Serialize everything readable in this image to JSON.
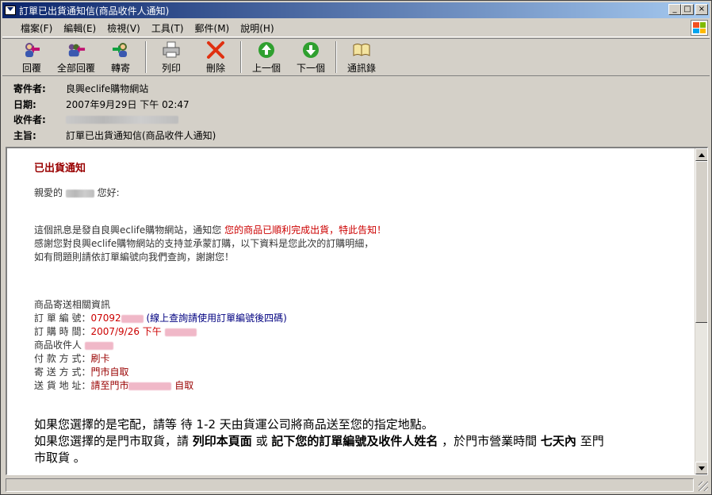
{
  "window": {
    "title": "訂單已出貨通知信(商品收件人通知)",
    "controls": [
      "_",
      "□",
      "×"
    ]
  },
  "menu": [
    "檔案(F)",
    "編輯(E)",
    "檢視(V)",
    "工具(T)",
    "郵件(M)",
    "說明(H)"
  ],
  "toolbar": {
    "reply": "回覆",
    "reply_all": "全部回覆",
    "forward": "轉寄",
    "print": "列印",
    "delete": "刪除",
    "prev": "上一個",
    "next": "下一個",
    "addresses": "通訊錄"
  },
  "headers": {
    "from_label": "寄件者:",
    "from_value": "良興eclife購物網站",
    "date_label": "日期:",
    "date_value": "2007年9月29日 下午 02:47",
    "to_label": "收件者:",
    "subject_label": "主旨:",
    "subject_value": "訂單已出貨通知信(商品收件人通知)"
  },
  "body": {
    "heading": "已出貨通知",
    "greeting_prefix": "親愛的",
    "greeting_suffix": "您好:",
    "para1_a": "這個訊息是發自良興eclife購物網站，通知您 ",
    "para1_b": "您的商品已順利完成出貨，特此告知！",
    "para2": "感謝您對良興eclife購物網站的支持並承蒙訂購，以下資料是您此次的訂購明細，",
    "para3": "如有問題則請依訂單編號向我們查詢，謝謝您！",
    "info_title": "商品寄送相關資訊",
    "order_no_label": "訂 單 編 號：",
    "order_no_value": "07092",
    "order_no_note": "(線上查詢請使用訂單編號後四碼)",
    "order_time_label": "訂 購 時 間：",
    "order_time_value": "2007/9/26 下午",
    "recipient_label": "商品收件人",
    "payment_label": "付 款 方 式：",
    "payment_value": "刷卡",
    "shipping_label": "寄 送 方 式：",
    "shipping_value": "門市自取",
    "address_label": "送 貨 地 址：",
    "address_value_a": "請至門市",
    "address_value_b": "自取",
    "notice1": "如果您選擇的是宅配，請等 待 1-2 天由貨運公司將商品送至您的指定地點。",
    "notice2_a": "如果您選擇的是門市取貨，請 ",
    "notice2_b": "列印本頁面",
    "notice2_c": " 或 ",
    "notice2_d": "記下您的訂單編號及收件人姓名",
    "notice2_e": " ，於門市營業時間 ",
    "notice2_f": "七天內",
    "notice2_g": " 至門",
    "notice2_h": "市取貨 。"
  }
}
